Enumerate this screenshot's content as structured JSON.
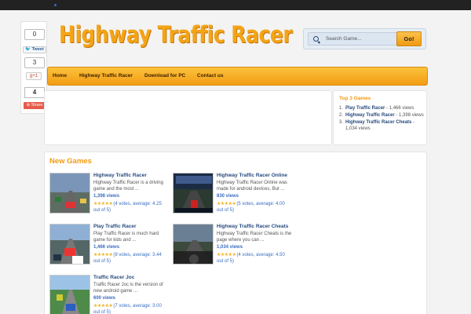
{
  "site": {
    "logo": "Highway Traffic Racer"
  },
  "search": {
    "placeholder": "Search Game...",
    "button": "Go!"
  },
  "share": {
    "count_fb": "0",
    "tweet": "Tweet",
    "count_tw": "3",
    "gplus": "g+1",
    "count_total": "4",
    "share_label": "Share"
  },
  "nav": {
    "items": [
      "Home",
      "Highway Traffic Racer",
      "Download for PC",
      "Contact us"
    ]
  },
  "top3": {
    "title": "Top 3 Games",
    "items": [
      {
        "num": "1.",
        "name": "Play Traffic Racer",
        "views": " - 1,466 views"
      },
      {
        "num": "2.",
        "name": "Highway Traffic Racer",
        "views": " - 1,398 views"
      },
      {
        "num": "3.",
        "name": "Highway Traffic Racer Cheats",
        "views": " - 1,034 views"
      }
    ]
  },
  "new_games": {
    "title": "New Games",
    "games": [
      {
        "title": "Highway Traffic Racer",
        "desc": "Highway Traffic Racer is a driving game and the most ...",
        "views": "1,398 views",
        "stars": "★★★★★",
        "rating": "(4 votes, average: 4.25 out of 5)"
      },
      {
        "title": "Highway Traffic Racer Online",
        "desc": "Highway Traffic Racer Online was made for android devices, But ...",
        "views": "830 views",
        "stars": "★★★★★",
        "rating": "(5 votes, average: 4.00 out of 5)"
      },
      {
        "title": "Play Traffic Racer",
        "desc": "Play Traffic Racer is much hard game for kids and ...",
        "views": "1,466 views",
        "stars": "★★★★★",
        "rating": "(9 votes, average: 3.44 out of 5)"
      },
      {
        "title": "Highway Traffic Racer Cheats",
        "desc": "Highway Traffic Racer Cheats is the page where you can ...",
        "views": "1,034 views",
        "stars": "★★★★★",
        "rating": "(4 votes, average: 4.50 out of 5)"
      },
      {
        "title": "Traffic Racer Joc",
        "desc": "Traffic Racer Joc is the version of new android game ...",
        "views": "600 views",
        "stars": "★★★★★",
        "rating": "(7 votes, average: 3.00 out of 5)"
      }
    ]
  },
  "colors": {
    "accent": "#f39a12",
    "link": "#274a7e",
    "topbar": "#222222"
  }
}
